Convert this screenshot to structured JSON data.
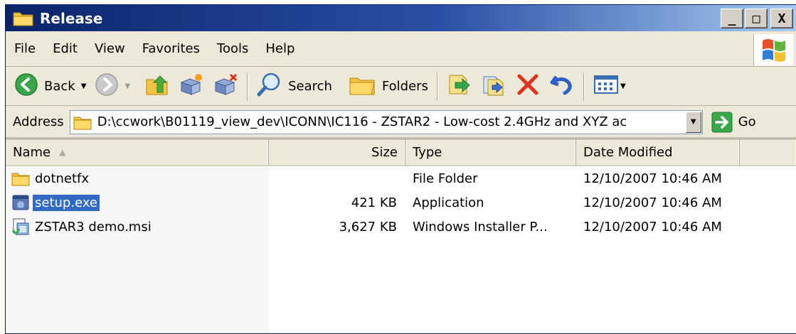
{
  "window": {
    "title": "Release",
    "minimize": "_",
    "maximize": "□",
    "close": "X"
  },
  "menu": {
    "items": [
      "File",
      "Edit",
      "View",
      "Favorites",
      "Tools",
      "Help"
    ]
  },
  "toolbar": {
    "back": "Back",
    "search": "Search",
    "folders": "Folders"
  },
  "address": {
    "label": "Address",
    "value": "D:\\ccwork\\B01119_view_dev\\ICONN\\IC116 - ZSTAR2 - Low-cost 2.4GHz and XYZ ac",
    "go": "Go"
  },
  "columns": {
    "name": "Name",
    "size": "Size",
    "type": "Type",
    "date": "Date Modified"
  },
  "files": [
    {
      "name": "dotnetfx",
      "size": "",
      "type": "File Folder",
      "date": "12/10/2007 10:46 AM",
      "icon": "folder-icon",
      "selected": false
    },
    {
      "name": "setup.exe",
      "size": "421 KB",
      "type": "Application",
      "date": "12/10/2007 10:46 AM",
      "icon": "application-icon",
      "selected": true
    },
    {
      "name": "ZSTAR3 demo.msi",
      "size": "3,627 KB",
      "type": "Windows Installer P...",
      "date": "12/10/2007 10:46 AM",
      "icon": "installer-icon",
      "selected": false
    }
  ],
  "colors": {
    "titlebar": "#0a246a",
    "selection": "#316ac5",
    "chrome": "#ece9d8"
  }
}
